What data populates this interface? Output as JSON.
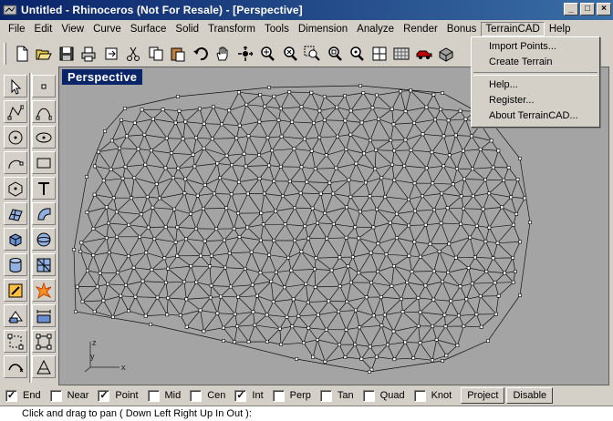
{
  "window": {
    "title": "Untitled - Rhinoceros (Not For Resale) - [Perspective]",
    "minimize_glyph": "_",
    "maximize_glyph": "□",
    "close_glyph": "×"
  },
  "menubar": {
    "items": [
      "File",
      "Edit",
      "View",
      "Curve",
      "Surface",
      "Solid",
      "Transform",
      "Tools",
      "Dimension",
      "Analyze",
      "Render",
      "Bonus",
      "TerrainCAD",
      "Help"
    ],
    "active": "TerrainCAD"
  },
  "terraincad_menu": {
    "items": [
      "Import Points...",
      "Create Terrain",
      "Help...",
      "Register...",
      "About TerrainCAD..."
    ]
  },
  "toolbar": {
    "icons": [
      "new-file-icon",
      "open-folder-icon",
      "save-icon",
      "print-icon",
      "export-icon",
      "cut-icon",
      "copy-icon",
      "paste-icon",
      "undo-icon",
      "pan-hand-icon",
      "rotate-view-icon",
      "zoom-in-icon",
      "zoom-dynamic-icon",
      "zoom-window-icon",
      "zoom-extents-icon",
      "zoom-selected-icon",
      "four-viewports-icon",
      "grid-icon",
      "car-render-icon",
      "render-box-icon"
    ]
  },
  "left_tools": {
    "icons": [
      "select-arrow-icon",
      "point-icon",
      "polyline-icon",
      "control-point-curve-icon",
      "circle-icon",
      "ellipse-icon",
      "arc-icon",
      "rectangle-icon",
      "polygon-icon",
      "text-icon",
      "surface-icon",
      "revolve-icon",
      "box-solid-icon",
      "sphere-icon",
      "cylinder-icon",
      "mesh-icon",
      "transform-icon",
      "explode-icon",
      "boolean-icon",
      "dimension-icon",
      "grid-snap-icon",
      "selection-icon",
      "curve-edit-icon",
      "analyze-icon"
    ]
  },
  "viewport": {
    "label": "Perspective",
    "axis_labels": {
      "x": "x",
      "y": "y",
      "z": "z"
    }
  },
  "osnaps": [
    {
      "label": "End",
      "checked": true
    },
    {
      "label": "Near",
      "checked": false
    },
    {
      "label": "Point",
      "checked": true
    },
    {
      "label": "Mid",
      "checked": false
    },
    {
      "label": "Cen",
      "checked": false
    },
    {
      "label": "Int",
      "checked": true
    },
    {
      "label": "Perp",
      "checked": false
    },
    {
      "label": "Tan",
      "checked": false
    },
    {
      "label": "Quad",
      "checked": false
    },
    {
      "label": "Knot",
      "checked": false
    }
  ],
  "osnap_buttons": [
    "Project",
    "Disable"
  ],
  "command_line": "Click and drag to pan ( Down  Left  Right  Up  In  Out ):",
  "colors": {
    "title_gradient_start": "#0a246a",
    "title_gradient_end": "#3a6ea5",
    "face": "#d4d0c8",
    "viewport_bg": "#a4a4a4"
  }
}
